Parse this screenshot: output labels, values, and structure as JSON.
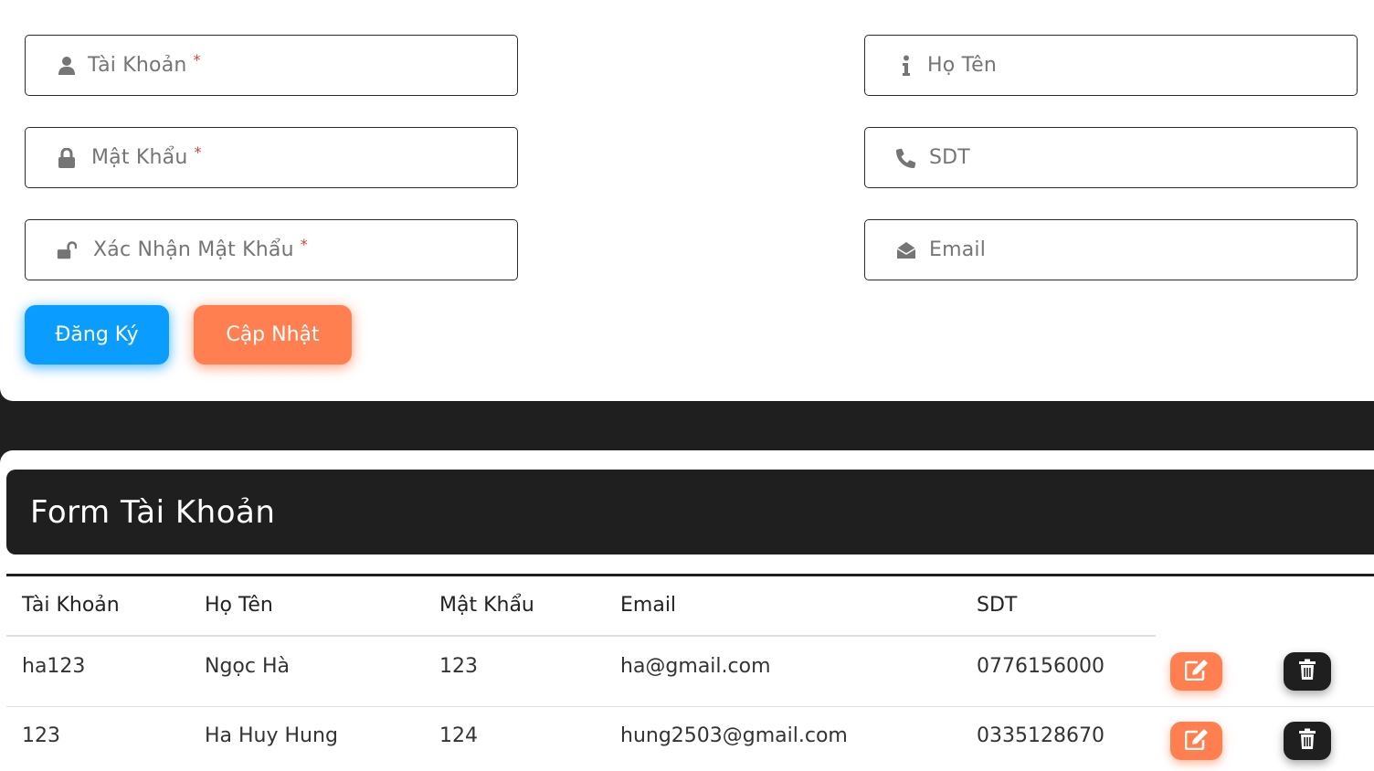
{
  "form": {
    "fields": {
      "username": {
        "placeholder": "Tài Khoản",
        "required": "*",
        "icon": "user-icon"
      },
      "password": {
        "placeholder": "Mật Khẩu",
        "required": "*",
        "icon": "lock-icon"
      },
      "confirm_password": {
        "placeholder": "Xác Nhận Mật Khẩu",
        "required": "*",
        "icon": "unlock-icon"
      },
      "fullname": {
        "placeholder": "Họ Tên",
        "icon": "info-icon"
      },
      "phone": {
        "placeholder": "SDT",
        "icon": "phone-icon"
      },
      "email": {
        "placeholder": "Email",
        "icon": "envelope-open-icon"
      }
    },
    "buttons": {
      "register": "Đăng Ký",
      "update": "Cập Nhật"
    }
  },
  "table": {
    "title": "Form Tài Khoản",
    "headers": {
      "username": "Tài Khoản",
      "fullname": "Họ Tên",
      "password": "Mật Khẩu",
      "email": "Email",
      "phone": "SDT"
    },
    "rows": [
      {
        "username": "ha123",
        "fullname": "Ngọc Hà",
        "password": "123",
        "email": "ha@gmail.com",
        "phone": "0776156000"
      },
      {
        "username": "123",
        "fullname": "Ha Huy Hung",
        "password": "124",
        "email": "hung2503@gmail.com",
        "phone": "0335128670"
      }
    ]
  },
  "colors": {
    "primary": "#0a9cff",
    "accent": "#ff7f50",
    "dark": "#1f1f1f",
    "required": "#e53935"
  }
}
